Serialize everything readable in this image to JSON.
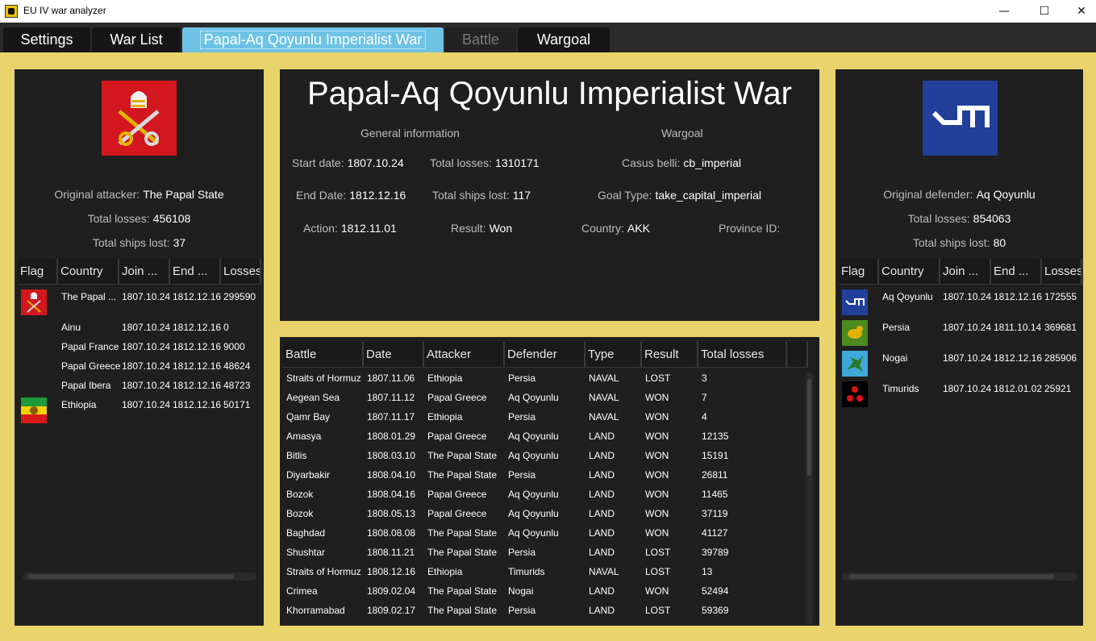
{
  "window": {
    "title": "EU IV war analyzer",
    "minimize": "—",
    "maximize": "☐",
    "close": "✕"
  },
  "tabs": [
    "Settings",
    "War List",
    "Papal-Aq Qoyunlu Imperialist War",
    "Battle",
    "Wargoal"
  ],
  "attacker": {
    "label_original": "Original attacker:",
    "original": "The Papal State",
    "label_losses": "Total losses:",
    "losses": "456108",
    "label_ships": "Total ships lost:",
    "ships": "37",
    "columns": [
      "Flag",
      "Country",
      "Join ...",
      "End ...",
      "Losses"
    ],
    "rows": [
      {
        "country": "The Papal ...",
        "join": "1807.10.24",
        "end": "1812.12.16",
        "losses": "299590",
        "flag": "papal"
      },
      {
        "country": "Ainu",
        "join": "1807.10.24",
        "end": "1812.12.16",
        "losses": "0",
        "flag": ""
      },
      {
        "country": "Papal France",
        "join": "1807.10.24",
        "end": "1812.12.16",
        "losses": "9000",
        "flag": ""
      },
      {
        "country": "Papal Greece",
        "join": "1807.10.24",
        "end": "1812.12.16",
        "losses": "48624",
        "flag": ""
      },
      {
        "country": "Papal Ibera",
        "join": "1807.10.24",
        "end": "1812.12.16",
        "losses": "48723",
        "flag": ""
      },
      {
        "country": "Ethiopia",
        "join": "1807.10.24",
        "end": "1812.12.16",
        "losses": "50171",
        "flag": "ethiopia"
      }
    ]
  },
  "defender": {
    "label_original": "Original defender:",
    "original": "Aq Qoyunlu",
    "label_losses": "Total losses:",
    "losses": "854063",
    "label_ships": "Total ships lost:",
    "ships": "80",
    "columns": [
      "Flag",
      "Country",
      "Join ...",
      "End ...",
      "Losses"
    ],
    "rows": [
      {
        "country": "Aq Qoyunlu",
        "join": "1807.10.24",
        "end": "1812.12.16",
        "losses": "172555",
        "flag": "akk"
      },
      {
        "country": "Persia",
        "join": "1807.10.24",
        "end": "1811.10.14",
        "losses": "369681",
        "flag": "persia"
      },
      {
        "country": "Nogai",
        "join": "1807.10.24",
        "end": "1812.12.16",
        "losses": "285906",
        "flag": "nogai"
      },
      {
        "country": "Timurids",
        "join": "1807.10.24",
        "end": "1812.01.02",
        "losses": "25921",
        "flag": "timurids"
      }
    ]
  },
  "war": {
    "title": "Papal-Aq Qoyunlu Imperialist War",
    "general_header": "General information",
    "wargoal_header": "Wargoal",
    "start_label": "Start date:",
    "start": "1807.10.24",
    "end_label": "End Date:",
    "end": "1812.12.16",
    "action_label": "Action:",
    "action": "1812.11.01",
    "losses_label": "Total losses:",
    "losses": "1310171",
    "ships_label": "Total ships lost:",
    "ships": "117",
    "result_label": "Result:",
    "result": "Won",
    "cb_label": "Casus belli:",
    "cb": "cb_imperial",
    "goal_label": "Goal Type:",
    "goal": "take_capital_imperial",
    "country_label": "Country:",
    "country": "AKK",
    "province_label": "Province ID:",
    "province": ""
  },
  "battles": {
    "columns": [
      "Battle",
      "Date",
      "Attacker",
      "Defender",
      "Type",
      "Result",
      "Total losses"
    ],
    "rows": [
      [
        "Straits of Hormuz",
        "1807.11.06",
        "Ethiopia",
        "Persia",
        "NAVAL",
        "LOST",
        "3"
      ],
      [
        "Aegean Sea",
        "1807.11.12",
        "Papal Greece",
        "Aq Qoyunlu",
        "NAVAL",
        "WON",
        "7"
      ],
      [
        "Qamr Bay",
        "1807.11.17",
        "Ethiopia",
        "Persia",
        "NAVAL",
        "WON",
        "4"
      ],
      [
        "Amasya",
        "1808.01.29",
        "Papal Greece",
        "Aq Qoyunlu",
        "LAND",
        "WON",
        "12135"
      ],
      [
        "Bitlis",
        "1808.03.10",
        "The Papal State",
        "Aq Qoyunlu",
        "LAND",
        "WON",
        "15191"
      ],
      [
        "Diyarbakir",
        "1808.04.10",
        "The Papal State",
        "Persia",
        "LAND",
        "WON",
        "26811"
      ],
      [
        "Bozok",
        "1808.04.16",
        "Papal Greece",
        "Aq Qoyunlu",
        "LAND",
        "WON",
        "11465"
      ],
      [
        "Bozok",
        "1808.05.13",
        "Papal Greece",
        "Aq Qoyunlu",
        "LAND",
        "WON",
        "37119"
      ],
      [
        "Baghdad",
        "1808.08.08",
        "The Papal State",
        "Aq Qoyunlu",
        "LAND",
        "WON",
        "41127"
      ],
      [
        "Shushtar",
        "1808.11.21",
        "The Papal State",
        "Persia",
        "LAND",
        "LOST",
        "39789"
      ],
      [
        "Straits of Hormuz",
        "1808.12.16",
        "Ethiopia",
        "Timurids",
        "NAVAL",
        "LOST",
        "13"
      ],
      [
        "Crimea",
        "1809.02.04",
        "The Papal State",
        "Nogai",
        "LAND",
        "WON",
        "52494"
      ],
      [
        "Khorramabad",
        "1809.02.17",
        "The Papal State",
        "Persia",
        "LAND",
        "LOST",
        "59369"
      ]
    ]
  }
}
